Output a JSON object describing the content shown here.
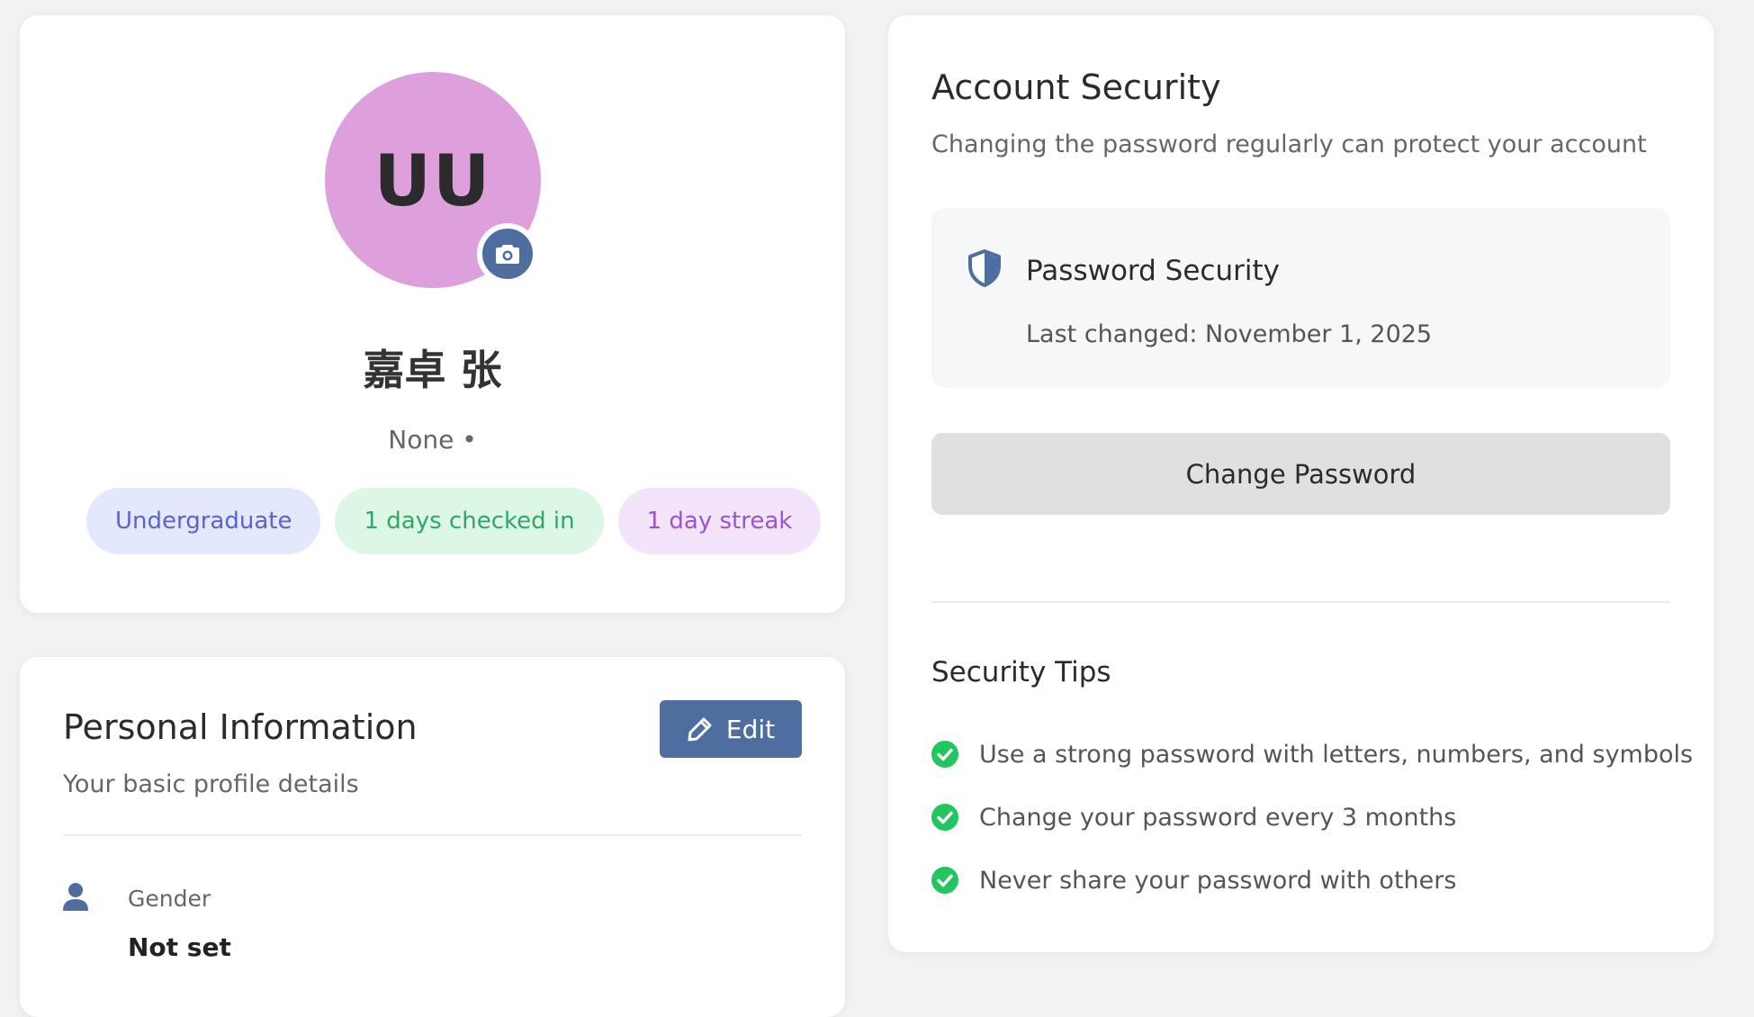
{
  "profile": {
    "avatar_initials": "UU",
    "avatar_color": "#dda0dd",
    "name": "嘉卓 张",
    "subtitle": "None •",
    "badges": [
      {
        "label": "Undergraduate",
        "color": "#5b63cf"
      },
      {
        "label": "1 days checked in",
        "color": "#2fa866"
      },
      {
        "label": "1 day streak",
        "color": "#9a52d6"
      }
    ]
  },
  "personal_info": {
    "title": "Personal Information",
    "description": "Your basic profile details",
    "edit_label": "Edit",
    "fields": [
      {
        "label": "Gender",
        "value": "Not set",
        "icon": "user-icon"
      }
    ]
  },
  "security": {
    "title": "Account Security",
    "description": "Changing the password regularly can protect your account",
    "password_box": {
      "icon": "shield-icon",
      "title": "Password Security",
      "last_changed": "Last changed: November 1, 2025"
    },
    "change_password_label": "Change Password",
    "tips_title": "Security Tips",
    "tips": [
      "Use a strong password with letters, numbers, and symbols",
      "Change your password every 3 months",
      "Never share your password with others"
    ],
    "tip_icon": "check-circle-icon"
  },
  "colors": {
    "accent": "#4f6ea0",
    "success": "#22c55e"
  }
}
